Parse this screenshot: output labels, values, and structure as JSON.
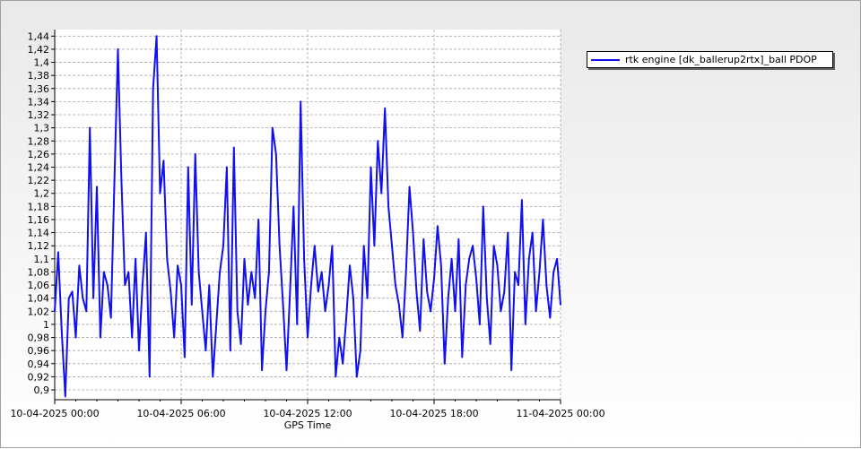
{
  "chart_data": {
    "type": "line",
    "title": "",
    "xlabel": "GPS Time",
    "ylabel": "",
    "xlim": [
      "2025-04-10 00:00",
      "2025-04-11 00:00"
    ],
    "ylim": [
      0.885,
      1.45
    ],
    "x_tick_labels": [
      "10-04-2025 00:00",
      "10-04-2025 06:00",
      "10-04-2025 12:00",
      "10-04-2025 18:00",
      "11-04-2025 00:00"
    ],
    "y_tick_labels": [
      "0,9",
      "0,92",
      "0,94",
      "0,96",
      "0,98",
      "1",
      "1,02",
      "1,04",
      "1,06",
      "1,08",
      "1,1",
      "1,12",
      "1,14",
      "1,16",
      "1,18",
      "1,2",
      "1,22",
      "1,24",
      "1,26",
      "1,28",
      "1,3",
      "1,32",
      "1,34",
      "1,36",
      "1,38",
      "1,4",
      "1,42",
      "1,44"
    ],
    "grid": true,
    "legend_position": "top-right",
    "series": [
      {
        "name": "rtk engine [dk_ballerup2rtx]_ball PDOP",
        "color": "#1010f0",
        "x": [
          "2025-04-10 00:00",
          "2025-04-10 00:10",
          "2025-04-10 00:20",
          "2025-04-10 00:30",
          "2025-04-10 00:40",
          "2025-04-10 00:50",
          "2025-04-10 01:00",
          "2025-04-10 01:10",
          "2025-04-10 01:20",
          "2025-04-10 01:30",
          "2025-04-10 01:40",
          "2025-04-10 01:50",
          "2025-04-10 02:00",
          "2025-04-10 02:10",
          "2025-04-10 02:20",
          "2025-04-10 02:30",
          "2025-04-10 02:40",
          "2025-04-10 02:50",
          "2025-04-10 03:00",
          "2025-04-10 03:10",
          "2025-04-10 03:20",
          "2025-04-10 03:30",
          "2025-04-10 03:40",
          "2025-04-10 03:50",
          "2025-04-10 04:00",
          "2025-04-10 04:10",
          "2025-04-10 04:20",
          "2025-04-10 04:30",
          "2025-04-10 04:40",
          "2025-04-10 04:50",
          "2025-04-10 05:00",
          "2025-04-10 05:10",
          "2025-04-10 05:20",
          "2025-04-10 05:30",
          "2025-04-10 05:40",
          "2025-04-10 05:50",
          "2025-04-10 06:00",
          "2025-04-10 06:10",
          "2025-04-10 06:20",
          "2025-04-10 06:30",
          "2025-04-10 06:40",
          "2025-04-10 06:50",
          "2025-04-10 07:00",
          "2025-04-10 07:10",
          "2025-04-10 07:20",
          "2025-04-10 07:30",
          "2025-04-10 07:40",
          "2025-04-10 07:50",
          "2025-04-10 08:00",
          "2025-04-10 08:10",
          "2025-04-10 08:20",
          "2025-04-10 08:30",
          "2025-04-10 08:40",
          "2025-04-10 08:50",
          "2025-04-10 09:00",
          "2025-04-10 09:10",
          "2025-04-10 09:20",
          "2025-04-10 09:30",
          "2025-04-10 09:40",
          "2025-04-10 09:50",
          "2025-04-10 10:00",
          "2025-04-10 10:10",
          "2025-04-10 10:20",
          "2025-04-10 10:30",
          "2025-04-10 10:40",
          "2025-04-10 10:50",
          "2025-04-10 11:00",
          "2025-04-10 11:10",
          "2025-04-10 11:20",
          "2025-04-10 11:30",
          "2025-04-10 11:40",
          "2025-04-10 11:50",
          "2025-04-10 12:00",
          "2025-04-10 12:10",
          "2025-04-10 12:20",
          "2025-04-10 12:30",
          "2025-04-10 12:40",
          "2025-04-10 12:50",
          "2025-04-10 13:00",
          "2025-04-10 13:10",
          "2025-04-10 13:20",
          "2025-04-10 13:30",
          "2025-04-10 13:40",
          "2025-04-10 13:50",
          "2025-04-10 14:00",
          "2025-04-10 14:10",
          "2025-04-10 14:20",
          "2025-04-10 14:30",
          "2025-04-10 14:40",
          "2025-04-10 14:50",
          "2025-04-10 15:00",
          "2025-04-10 15:10",
          "2025-04-10 15:20",
          "2025-04-10 15:30",
          "2025-04-10 15:40",
          "2025-04-10 15:50",
          "2025-04-10 16:00",
          "2025-04-10 16:10",
          "2025-04-10 16:20",
          "2025-04-10 16:30",
          "2025-04-10 16:40",
          "2025-04-10 16:50",
          "2025-04-10 17:00",
          "2025-04-10 17:10",
          "2025-04-10 17:20",
          "2025-04-10 17:30",
          "2025-04-10 17:40",
          "2025-04-10 17:50",
          "2025-04-10 18:00",
          "2025-04-10 18:10",
          "2025-04-10 18:20",
          "2025-04-10 18:30",
          "2025-04-10 18:40",
          "2025-04-10 18:50",
          "2025-04-10 19:00",
          "2025-04-10 19:10",
          "2025-04-10 19:20",
          "2025-04-10 19:30",
          "2025-04-10 19:40",
          "2025-04-10 19:50",
          "2025-04-10 20:00",
          "2025-04-10 20:10",
          "2025-04-10 20:20",
          "2025-04-10 20:30",
          "2025-04-10 20:40",
          "2025-04-10 20:50",
          "2025-04-10 21:00",
          "2025-04-10 21:10",
          "2025-04-10 21:20",
          "2025-04-10 21:30",
          "2025-04-10 21:40",
          "2025-04-10 21:50",
          "2025-04-10 22:00",
          "2025-04-10 22:10",
          "2025-04-10 22:20",
          "2025-04-10 22:30",
          "2025-04-10 22:40",
          "2025-04-10 22:50",
          "2025-04-10 23:00",
          "2025-04-10 23:10",
          "2025-04-10 23:20",
          "2025-04-10 23:30",
          "2025-04-10 23:40",
          "2025-04-10 23:50",
          "2025-04-11 00:00"
        ],
        "y": [
          1.02,
          1.11,
          0.99,
          0.89,
          1.04,
          1.05,
          0.98,
          1.09,
          1.04,
          1.02,
          1.3,
          1.04,
          1.21,
          0.98,
          1.08,
          1.06,
          1.01,
          1.22,
          1.42,
          1.22,
          1.06,
          1.08,
          0.98,
          1.1,
          0.96,
          1.06,
          1.14,
          0.92,
          1.36,
          1.44,
          1.2,
          1.25,
          1.1,
          1.05,
          0.98,
          1.09,
          1.06,
          0.95,
          1.24,
          1.03,
          1.26,
          1.08,
          1.02,
          0.96,
          1.06,
          0.92,
          1.0,
          1.08,
          1.12,
          1.24,
          0.96,
          1.27,
          1.02,
          0.97,
          1.1,
          1.03,
          1.08,
          1.04,
          1.16,
          0.93,
          1.02,
          1.08,
          1.3,
          1.26,
          1.12,
          1.03,
          0.93,
          1.05,
          1.18,
          1.0,
          1.34,
          1.1,
          0.98,
          1.06,
          1.12,
          1.05,
          1.08,
          1.02,
          1.06,
          1.12,
          0.92,
          0.98,
          0.94,
          1.01,
          1.09,
          1.04,
          0.92,
          0.96,
          1.12,
          1.04,
          1.24,
          1.12,
          1.28,
          1.2,
          1.33,
          1.18,
          1.12,
          1.06,
          1.03,
          0.98,
          1.08,
          1.21,
          1.14,
          1.05,
          0.99,
          1.13,
          1.05,
          1.02,
          1.07,
          1.15,
          1.09,
          0.94,
          1.04,
          1.1,
          1.02,
          1.13,
          0.95,
          1.06,
          1.1,
          1.12,
          1.07,
          1.0,
          1.18,
          1.04,
          0.97,
          1.12,
          1.09,
          1.02,
          1.05,
          1.14,
          0.93,
          1.08,
          1.06,
          1.19,
          1.0,
          1.1,
          1.14,
          1.02,
          1.08,
          1.16,
          1.06,
          1.01,
          1.08,
          1.1,
          1.03
        ]
      }
    ]
  }
}
